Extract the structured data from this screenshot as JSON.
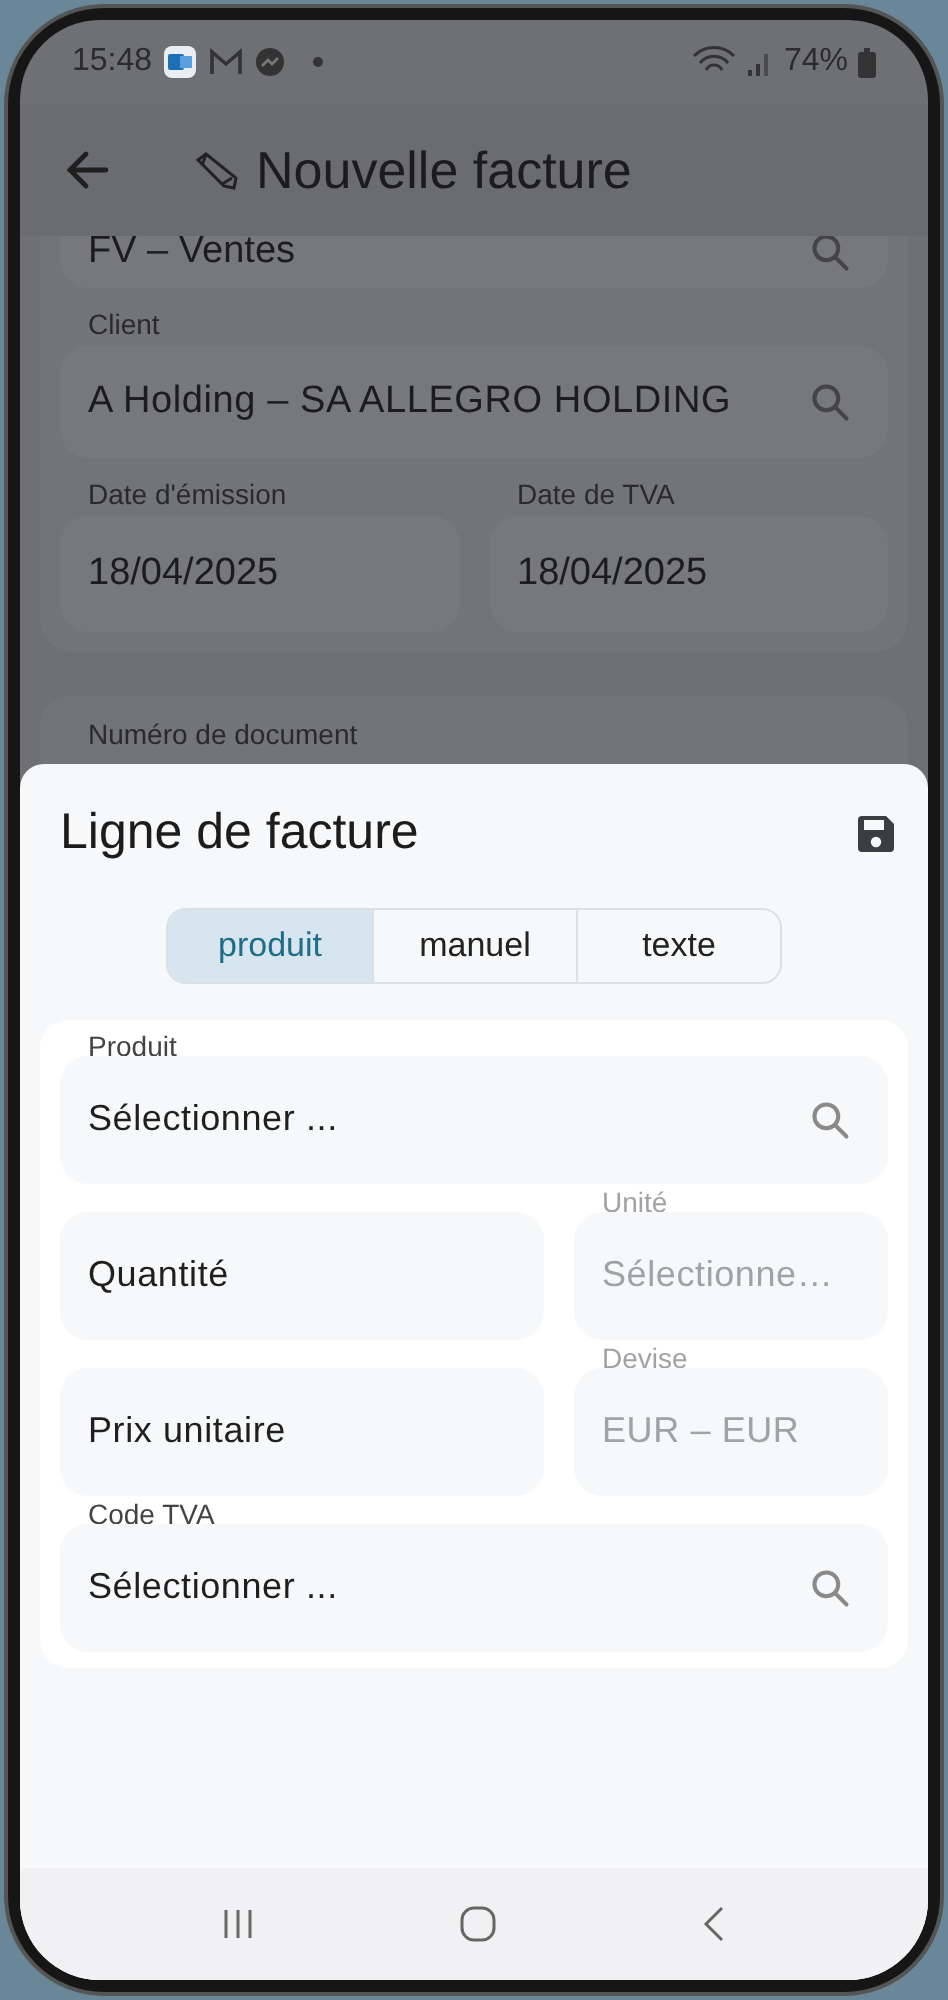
{
  "status_bar": {
    "time": "15:48",
    "battery": "74%"
  },
  "app_bar": {
    "title": "Nouvelle facture"
  },
  "form": {
    "journal_value": "FV – Ventes",
    "client": {
      "label": "Client",
      "value": "A Holding – SA ALLEGRO HOLDING"
    },
    "dates": [
      {
        "label": "Date d'émission",
        "value": "18/04/2025"
      },
      {
        "label": "Date de TVA",
        "value": "18/04/2025"
      }
    ],
    "document_number": {
      "label": "Numéro de document"
    }
  },
  "sheet": {
    "title": "Ligne de facture",
    "tabs": [
      {
        "label": "produit",
        "selected": true
      },
      {
        "label": "manuel",
        "selected": false
      },
      {
        "label": "texte",
        "selected": false
      }
    ],
    "rows": [
      {
        "fields": [
          {
            "kind": "search",
            "label": "Produit",
            "placeholder": "Sélectionner ...",
            "disabled": false
          }
        ]
      },
      {
        "fields": [
          {
            "kind": "input",
            "placeholder": "Quantité",
            "disabled": false
          },
          {
            "kind": "select",
            "label": "Unité",
            "placeholder": "Sélectionne…",
            "disabled": true
          }
        ]
      },
      {
        "fields": [
          {
            "kind": "input",
            "placeholder": "Prix unitaire",
            "disabled": false
          },
          {
            "kind": "select",
            "label": "Devise",
            "placeholder": "EUR – EUR",
            "disabled": true
          }
        ]
      },
      {
        "fields": [
          {
            "kind": "search",
            "label": "Code TVA",
            "placeholder": "Sélectionner ...",
            "disabled": false
          }
        ]
      }
    ]
  }
}
